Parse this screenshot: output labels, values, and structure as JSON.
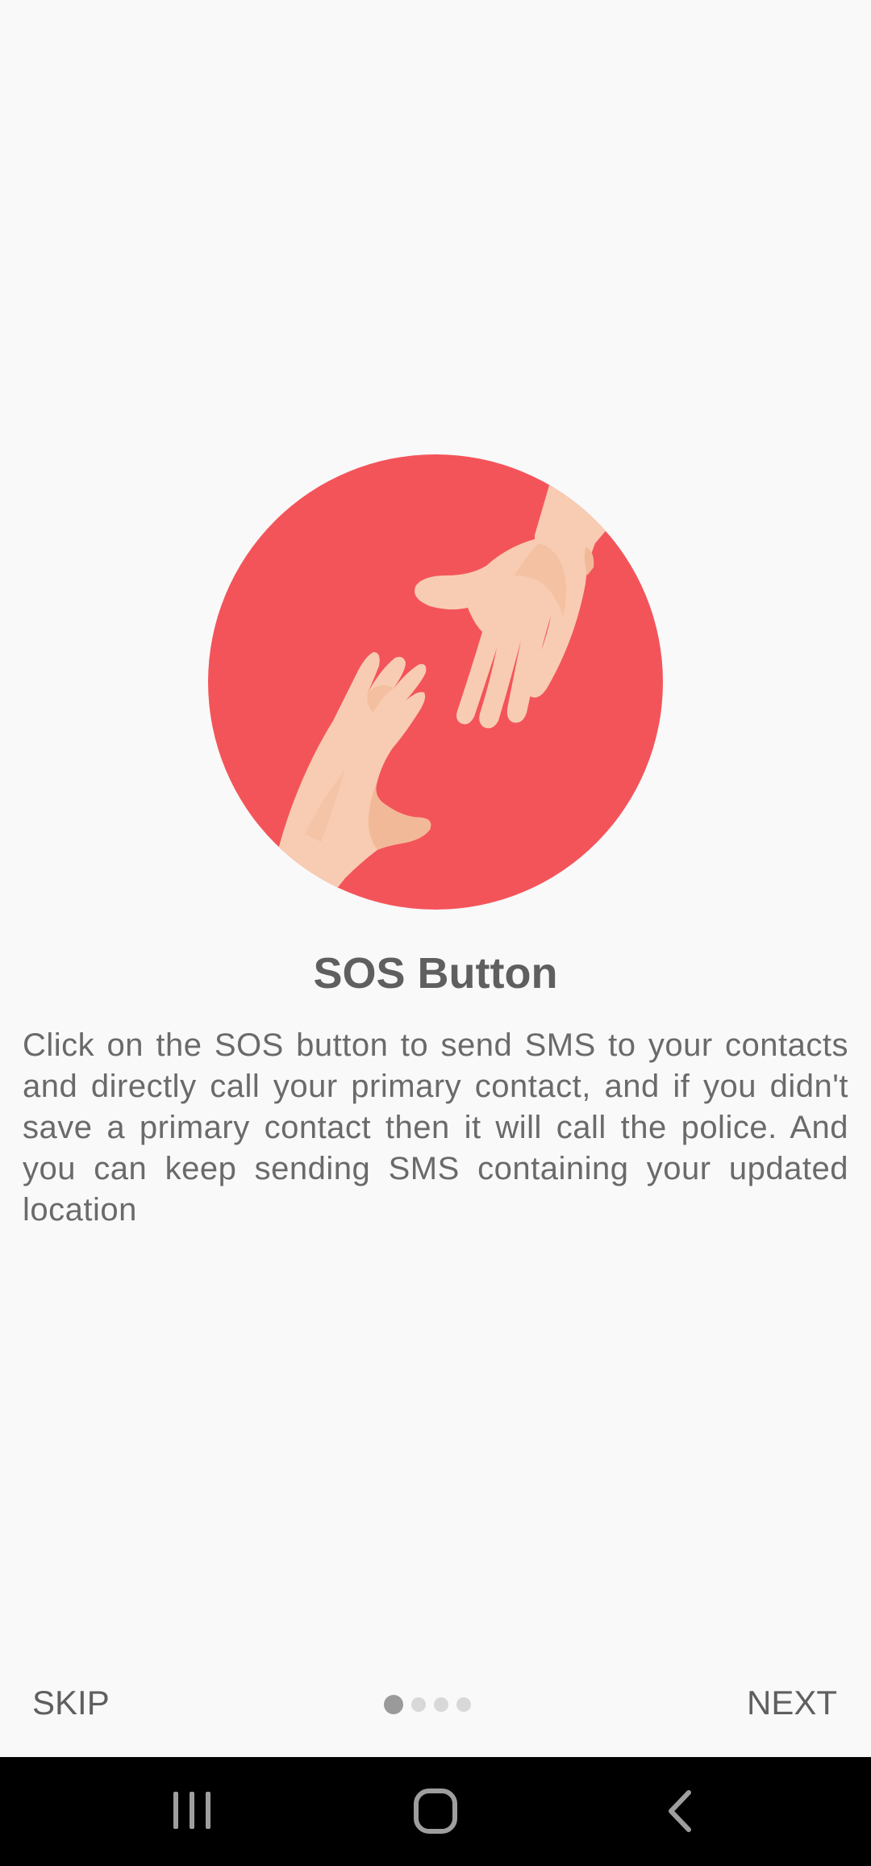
{
  "onboarding": {
    "title": "SOS Button",
    "description": "Click on the SOS button to send SMS to your contacts and directly call your primary contact, and if you didn't save a primary contact then it will call the police. And you can keep sending SMS containing your updated location",
    "illustration_icon": "helping-hands-icon",
    "accent_color": "#f3545a",
    "skin_color": "#f8ccb2"
  },
  "footer": {
    "skip_label": "SKIP",
    "next_label": "NEXT",
    "page_count": 4,
    "active_page": 1
  },
  "navigation": {
    "recents_icon": "recents-icon",
    "home_icon": "home-icon",
    "back_icon": "back-icon"
  }
}
